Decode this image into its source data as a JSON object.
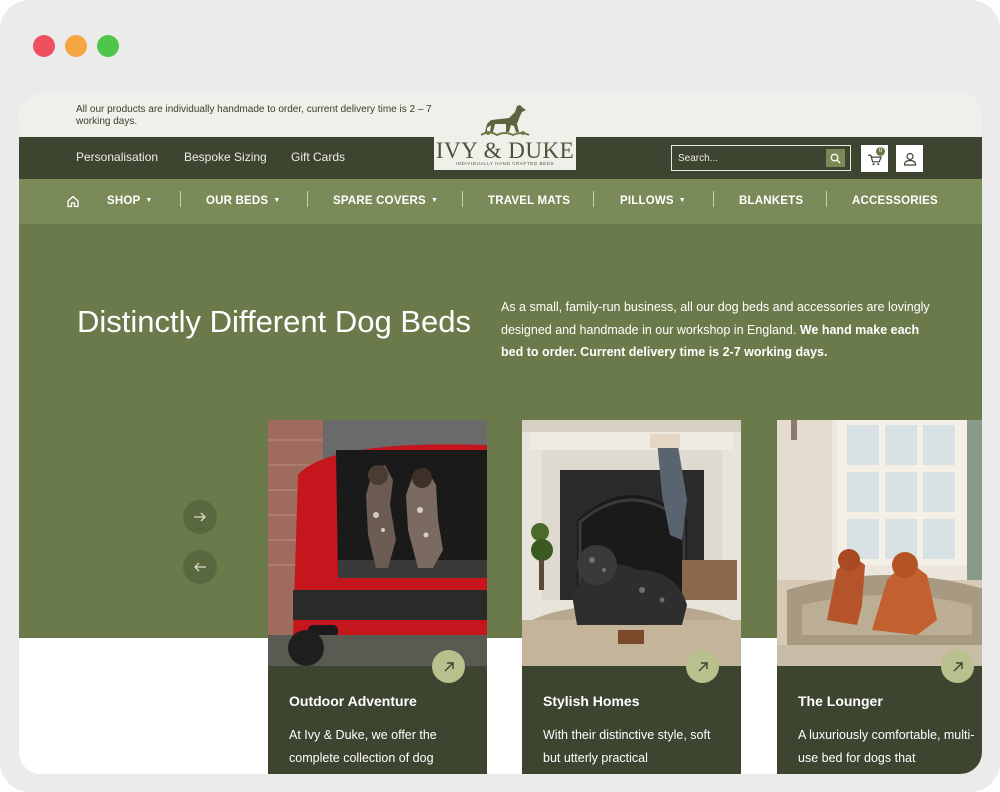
{
  "notice": "All our products are individually handmade to order, current delivery time is 2 – 7 working days.",
  "logo": {
    "name": "IVY & DUKE",
    "tagline": "INDIVIDUALLY HAND CRAFTED BEDS"
  },
  "top_links": [
    "Personalisation",
    "Bespoke Sizing",
    "Gift Cards"
  ],
  "search": {
    "placeholder": "Search..."
  },
  "cart": {
    "count": "0"
  },
  "menu": [
    {
      "label": "SHOP",
      "dropdown": true
    },
    {
      "label": "OUR BEDS",
      "dropdown": true
    },
    {
      "label": "SPARE COVERS",
      "dropdown": true
    },
    {
      "label": "TRAVEL MATS",
      "dropdown": false
    },
    {
      "label": "PILLOWS",
      "dropdown": true
    },
    {
      "label": "BLANKETS",
      "dropdown": false
    },
    {
      "label": "ACCESSORIES",
      "dropdown": false
    }
  ],
  "hero": {
    "title": "Distinctly Different Dog Beds",
    "text": "As a small, family-run business, all our dog beds and accessories are lovingly designed and handmade in our workshop in England.",
    "text_bold": "We hand make each bed to order. Current delivery time is 2-7 working days."
  },
  "cards": [
    {
      "title": "Outdoor Adventure",
      "text": "At Ivy & Duke, we offer the complete collection of dog"
    },
    {
      "title": "Stylish Homes",
      "text": "With their distinctive style, soft but utterly practical"
    },
    {
      "title": "The Lounger",
      "text": "A luxuriously comfortable, multi-use bed for dogs that"
    }
  ],
  "colors": {
    "dark_olive": "#3d4430",
    "menu_green": "#7a8a58",
    "hero_green": "#6b7a4a",
    "cream": "#f1efe9"
  },
  "icons": [
    "home-icon",
    "search-icon",
    "cart-icon",
    "user-icon",
    "arrow-right-icon",
    "arrow-left-icon",
    "arrow-up-right-icon"
  ]
}
